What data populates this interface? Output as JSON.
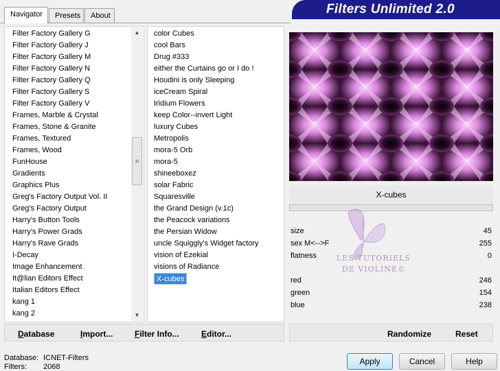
{
  "tabs": [
    "Navigator",
    "Presets",
    "About"
  ],
  "banner_title": "Filters Unlimited 2.0",
  "categories": [
    "Filter Factory Gallery G",
    "Filter Factory Gallery J",
    "Filter Factory Gallery M",
    "Filter Factory Gallery N",
    "Filter Factory Gallery Q",
    "Filter Factory Gallery S",
    "Filter Factory Gallery V",
    "Frames, Marble & Crystal",
    "Frames, Stone & Granite",
    "Frames, Textured",
    "Frames, Wood",
    "FunHouse",
    "Gradients",
    "Graphics Plus",
    "Greg's Factory Output Vol. II",
    "Greg's Factory Output",
    "Harry's Button Tools",
    "Harry's Power Grads",
    "Harry's Rave Grads",
    "I-Decay",
    "Image Enhancement",
    "It@lian Editors Effect",
    "Italian Editors Effect",
    "kang 1",
    "kang 2"
  ],
  "filters": [
    "color Cubes",
    "cool Bars",
    "Drug #333",
    "either the Curtains go or I do !",
    "Houdini is only Sleeping",
    "iceCream Spiral",
    "Iridium Flowers",
    "keep Color--invert Light",
    "luxury Cubes",
    "Metropolis",
    "mora-5 Orb",
    "mora-5",
    "shineeboxez",
    "solar Fabric",
    "Squaresville",
    "the Grand Design     (v.1c)",
    "the Peacock variations",
    "the Persian Widow",
    "uncle Squiggly's Widget factory",
    "vision of Ezekial",
    "visions of Radiance",
    "X-cubes"
  ],
  "selected_filter": "X-cubes",
  "left_toolbar": [
    {
      "pre": "",
      "ul": "D",
      "post": "atabase"
    },
    {
      "pre": "",
      "ul": "I",
      "post": "mport..."
    },
    {
      "pre": "",
      "ul": "F",
      "post": "ilter Info..."
    },
    {
      "pre": "",
      "ul": "E",
      "post": "ditor..."
    }
  ],
  "right_toolbar": {
    "randomize": "Randomize",
    "reset": "Reset"
  },
  "watermark_lines": [
    "LES TUTORIELS",
    "DE VIOLINE©"
  ],
  "params": [
    {
      "label": "size",
      "value": "45"
    },
    {
      "label": "sex  M<-->F",
      "value": "255"
    },
    {
      "label": "flatness",
      "value": "0"
    },
    {
      "label": "red",
      "value": "246"
    },
    {
      "label": "green",
      "value": "154"
    },
    {
      "label": "blue",
      "value": "238"
    }
  ],
  "status": {
    "database_label": "Database:",
    "database_value": "ICNET-Filters",
    "filters_label": "Filters:",
    "filters_value": "2068"
  },
  "buttons": {
    "apply": "Apply",
    "cancel": "Cancel",
    "help": "Help"
  },
  "colors": {
    "banner": "#1c1c8c",
    "selection": "#3a86d8",
    "preview_pink": "#e7a6ea"
  }
}
